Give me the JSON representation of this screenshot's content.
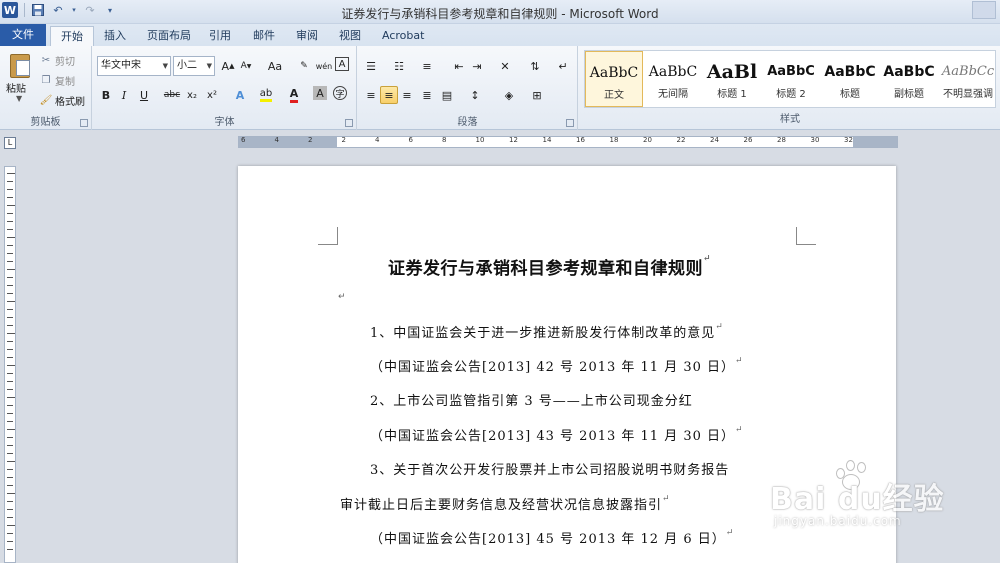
{
  "window": {
    "title": "证券发行与承销科目参考规章和自律规则 - Microsoft Word",
    "logo": "W"
  },
  "quick_access": [
    "save-icon",
    "undo-icon",
    "redo-icon",
    "customize-icon"
  ],
  "tabs": [
    {
      "label": "文件"
    },
    {
      "label": "开始"
    },
    {
      "label": "插入"
    },
    {
      "label": "页面布局"
    },
    {
      "label": "引用"
    },
    {
      "label": "邮件"
    },
    {
      "label": "审阅"
    },
    {
      "label": "视图"
    },
    {
      "label": "Acrobat"
    }
  ],
  "clipboard": {
    "paste_label": "粘贴",
    "cut_label": "剪切",
    "copy_label": "复制",
    "format_painter_label": "格式刷",
    "group_label": "剪贴板"
  },
  "font": {
    "family": "华文中宋",
    "size": "小二",
    "group_label": "字体",
    "buttons": {
      "grow": "A",
      "shrink": "A",
      "case": "Aa",
      "bold": "B",
      "italic": "I",
      "underline": "U",
      "strike": "abc",
      "subscript": "x₂",
      "superscript": "x²",
      "font_color": "A",
      "char_shading": "A"
    }
  },
  "paragraph": {
    "group_label": "段落"
  },
  "styles": {
    "group_label": "样式",
    "items": [
      {
        "sample": "AaBbC",
        "name": "正文"
      },
      {
        "sample": "AaBbC",
        "name": "无间隔"
      },
      {
        "sample": "AaBl",
        "name": "标题 1"
      },
      {
        "sample": "AaBbC",
        "name": "标题 2"
      },
      {
        "sample": "AaBbC",
        "name": "标题"
      },
      {
        "sample": "AaBbC",
        "name": "副标题"
      },
      {
        "sample": "AaBbCc",
        "name": "不明显强调"
      }
    ]
  },
  "ruler": {
    "corner": "L",
    "numbers": [
      "6",
      "4",
      "2",
      "2",
      "4",
      "6",
      "8",
      "10",
      "12",
      "14",
      "16",
      "18",
      "20",
      "22",
      "24",
      "26",
      "28",
      "30",
      "32"
    ]
  },
  "document": {
    "title": "证券发行与承销科目参考规章和自律规则",
    "paragraph_mark": "↵",
    "lines": [
      "1、中国证监会关于进一步推进新股发行体制改革的意见",
      "（中国证监会公告[2013]  42 号     2013 年  11 月  30 日）",
      "2、上市公司监管指引第  3 号——上市公司现金分红",
      "（中国证监会公告[2013]  43 号     2013 年  11 月  30 日）",
      "3、关于首次公开发行股票并上市公司招股说明书财务报告",
      "审计截止日后主要财务信息及经营状况信息披露指引",
      "（中国证监会公告[2013]  45 号     2013 年  12 月  6 日）"
    ]
  },
  "watermark": {
    "brand": "Bai  du经验",
    "url": "jingyan.baidu.com"
  }
}
